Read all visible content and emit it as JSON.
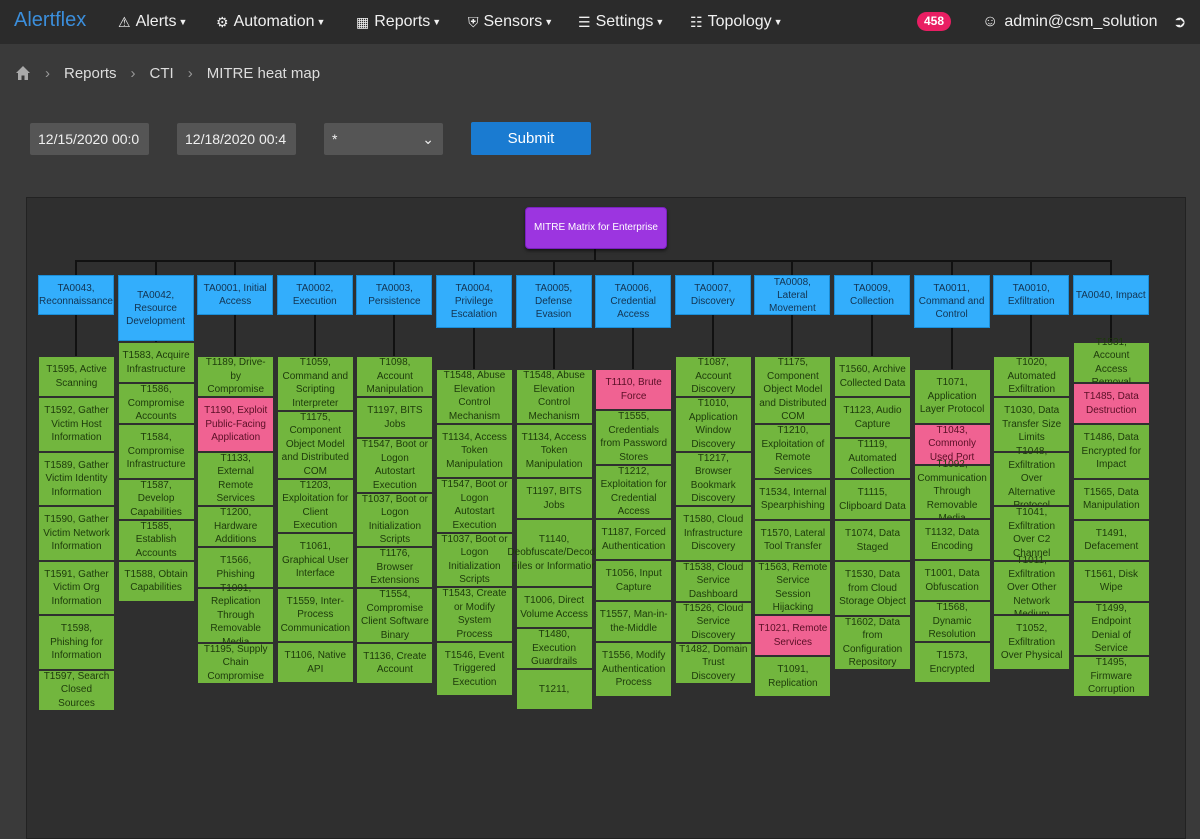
{
  "app": {
    "brand": "Alertflex"
  },
  "nav": {
    "items": [
      {
        "label": "Alerts",
        "icon": "warning-icon"
      },
      {
        "label": "Automation",
        "icon": "robot-icon"
      },
      {
        "label": "Reports",
        "icon": "table-icon"
      },
      {
        "label": "Sensors",
        "icon": "shield-icon"
      },
      {
        "label": "Settings",
        "icon": "sliders-icon"
      },
      {
        "label": "Topology",
        "icon": "sitemap-icon"
      }
    ],
    "badge": "458",
    "user": "admin@csm_solution"
  },
  "breadcrumb": [
    "Reports",
    "CTI",
    "MITRE heat map"
  ],
  "filters": {
    "date_from": "12/15/2020 00:0",
    "date_to": "12/18/2020 00:4",
    "select_value": "*",
    "submit_label": "Submit"
  },
  "colors": {
    "tactic": "#33aefc",
    "technique": "#72b63e",
    "hit": "#f06292",
    "root": "#9c35e0"
  },
  "heatmap": {
    "root": "MITRE Matrix for Enterprise",
    "tactics": [
      {
        "label": "TA0043, Reconnaissance",
        "techniques": [
          {
            "label": "T1595, Active Scanning",
            "hit": false
          },
          {
            "label": "T1592, Gather Victim Host Information",
            "hit": false
          },
          {
            "label": "T1589, Gather Victim Identity Information",
            "hit": false
          },
          {
            "label": "T1590, Gather Victim Network Information",
            "hit": false
          },
          {
            "label": "T1591, Gather Victim Org Information",
            "hit": false
          },
          {
            "label": "T1598, Phishing for Information",
            "hit": false
          },
          {
            "label": "T1597, Search Closed Sources",
            "hit": false
          }
        ]
      },
      {
        "label": "TA0042, Resource Development",
        "techniques": [
          {
            "label": "T1583, Acquire Infrastructure",
            "hit": false
          },
          {
            "label": "T1586, Compromise Accounts",
            "hit": false
          },
          {
            "label": "T1584, Compromise Infrastructure",
            "hit": false
          },
          {
            "label": "T1587, Develop Capabilities",
            "hit": false
          },
          {
            "label": "T1585, Establish Accounts",
            "hit": false
          },
          {
            "label": "T1588, Obtain Capabilities",
            "hit": false
          }
        ]
      },
      {
        "label": "TA0001, Initial Access",
        "techniques": [
          {
            "label": "T1189, Drive-by Compromise",
            "hit": false
          },
          {
            "label": "T1190, Exploit Public-Facing Application",
            "hit": true
          },
          {
            "label": "T1133, External Remote Services",
            "hit": false
          },
          {
            "label": "T1200, Hardware Additions",
            "hit": false
          },
          {
            "label": "T1566, Phishing",
            "hit": false
          },
          {
            "label": "T1091, Replication Through Removable Media",
            "hit": false
          },
          {
            "label": "T1195, Supply Chain Compromise",
            "hit": false
          }
        ]
      },
      {
        "label": "TA0002, Execution",
        "techniques": [
          {
            "label": "T1059, Command and Scripting Interpreter",
            "hit": false
          },
          {
            "label": "T1175, Component Object Model and Distributed COM",
            "hit": false
          },
          {
            "label": "T1203, Exploitation for Client Execution",
            "hit": false
          },
          {
            "label": "T1061, Graphical User Interface",
            "hit": false
          },
          {
            "label": "T1559, Inter-Process Communication",
            "hit": false
          },
          {
            "label": "T1106, Native API",
            "hit": false
          }
        ]
      },
      {
        "label": "TA0003, Persistence",
        "techniques": [
          {
            "label": "T1098, Account Manipulation",
            "hit": false
          },
          {
            "label": "T1197, BITS Jobs",
            "hit": false
          },
          {
            "label": "T1547, Boot or Logon Autostart Execution",
            "hit": false
          },
          {
            "label": "T1037, Boot or Logon Initialization Scripts",
            "hit": false
          },
          {
            "label": "T1176, Browser Extensions",
            "hit": false
          },
          {
            "label": "T1554, Compromise Client Software Binary",
            "hit": false
          },
          {
            "label": "T1136, Create Account",
            "hit": false
          }
        ]
      },
      {
        "label": "TA0004, Privilege Escalation",
        "techniques": [
          {
            "label": "T1548, Abuse Elevation Control Mechanism",
            "hit": false
          },
          {
            "label": "T1134, Access Token Manipulation",
            "hit": false
          },
          {
            "label": "T1547, Boot or Logon Autostart Execution",
            "hit": false
          },
          {
            "label": "T1037, Boot or Logon Initialization Scripts",
            "hit": false
          },
          {
            "label": "T1543, Create or Modify System Process",
            "hit": false
          },
          {
            "label": "T1546, Event Triggered Execution",
            "hit": false
          }
        ]
      },
      {
        "label": "TA0005, Defense Evasion",
        "techniques": [
          {
            "label": "T1548, Abuse Elevation Control Mechanism",
            "hit": false
          },
          {
            "label": "T1134, Access Token Manipulation",
            "hit": false
          },
          {
            "label": "T1197, BITS Jobs",
            "hit": false
          },
          {
            "label": "T1140, Deobfuscate/Decode Files or Information",
            "hit": false
          },
          {
            "label": "T1006, Direct Volume Access",
            "hit": false
          },
          {
            "label": "T1480, Execution Guardrails",
            "hit": false
          },
          {
            "label": "T1211,",
            "hit": false
          }
        ]
      },
      {
        "label": "TA0006, Credential Access",
        "techniques": [
          {
            "label": "T1110, Brute Force",
            "hit": true
          },
          {
            "label": "T1555, Credentials from Password Stores",
            "hit": false
          },
          {
            "label": "T1212, Exploitation for Credential Access",
            "hit": false
          },
          {
            "label": "T1187, Forced Authentication",
            "hit": false
          },
          {
            "label": "T1056, Input Capture",
            "hit": false
          },
          {
            "label": "T1557, Man-in-the-Middle",
            "hit": false
          },
          {
            "label": "T1556, Modify Authentication Process",
            "hit": false
          }
        ]
      },
      {
        "label": "TA0007, Discovery",
        "techniques": [
          {
            "label": "T1087, Account Discovery",
            "hit": false
          },
          {
            "label": "T1010, Application Window Discovery",
            "hit": false
          },
          {
            "label": "T1217, Browser Bookmark Discovery",
            "hit": false
          },
          {
            "label": "T1580, Cloud Infrastructure Discovery",
            "hit": false
          },
          {
            "label": "T1538, Cloud Service Dashboard",
            "hit": false
          },
          {
            "label": "T1526, Cloud Service Discovery",
            "hit": false
          },
          {
            "label": "T1482, Domain Trust Discovery",
            "hit": false
          }
        ]
      },
      {
        "label": "TA0008, Lateral Movement",
        "techniques": [
          {
            "label": "T1175, Component Object Model and Distributed COM",
            "hit": false
          },
          {
            "label": "T1210, Exploitation of Remote Services",
            "hit": false
          },
          {
            "label": "T1534, Internal Spearphishing",
            "hit": false
          },
          {
            "label": "T1570, Lateral Tool Transfer",
            "hit": false
          },
          {
            "label": "T1563, Remote Service Session Hijacking",
            "hit": false
          },
          {
            "label": "T1021, Remote Services",
            "hit": true
          },
          {
            "label": "T1091, Replication",
            "hit": false
          }
        ]
      },
      {
        "label": "TA0009, Collection",
        "techniques": [
          {
            "label": "T1560, Archive Collected Data",
            "hit": false
          },
          {
            "label": "T1123, Audio Capture",
            "hit": false
          },
          {
            "label": "T1119, Automated Collection",
            "hit": false
          },
          {
            "label": "T1115, Clipboard Data",
            "hit": false
          },
          {
            "label": "T1074, Data Staged",
            "hit": false
          },
          {
            "label": "T1530, Data from Cloud Storage Object",
            "hit": false
          },
          {
            "label": "T1602, Data from Configuration Repository",
            "hit": false
          }
        ]
      },
      {
        "label": "TA0011, Command and Control",
        "techniques": [
          {
            "label": "T1071, Application Layer Protocol",
            "hit": false
          },
          {
            "label": "T1043, Commonly Used Port",
            "hit": true
          },
          {
            "label": "T1092, Communication Through Removable Media",
            "hit": false
          },
          {
            "label": "T1132, Data Encoding",
            "hit": false
          },
          {
            "label": "T1001, Data Obfuscation",
            "hit": false
          },
          {
            "label": "T1568, Dynamic Resolution",
            "hit": false
          },
          {
            "label": "T1573, Encrypted",
            "hit": false
          }
        ]
      },
      {
        "label": "TA0010, Exfiltration",
        "techniques": [
          {
            "label": "T1020, Automated Exfiltration",
            "hit": false
          },
          {
            "label": "T1030, Data Transfer Size Limits",
            "hit": false
          },
          {
            "label": "T1048, Exfiltration Over Alternative Protocol",
            "hit": false
          },
          {
            "label": "T1041, Exfiltration Over C2 Channel",
            "hit": false
          },
          {
            "label": "T1011, Exfiltration Over Other Network Medium",
            "hit": false
          },
          {
            "label": "T1052, Exfiltration Over Physical",
            "hit": false
          }
        ]
      },
      {
        "label": "TA0040, Impact",
        "techniques": [
          {
            "label": "T1531, Account Access Removal",
            "hit": false
          },
          {
            "label": "T1485, Data Destruction",
            "hit": true
          },
          {
            "label": "T1486, Data Encrypted for Impact",
            "hit": false
          },
          {
            "label": "T1565, Data Manipulation",
            "hit": false
          },
          {
            "label": "T1491, Defacement",
            "hit": false
          },
          {
            "label": "T1561, Disk Wipe",
            "hit": false
          },
          {
            "label": "T1499, Endpoint Denial of Service",
            "hit": false
          },
          {
            "label": "T1495, Firmware Corruption",
            "hit": false
          }
        ]
      }
    ]
  }
}
